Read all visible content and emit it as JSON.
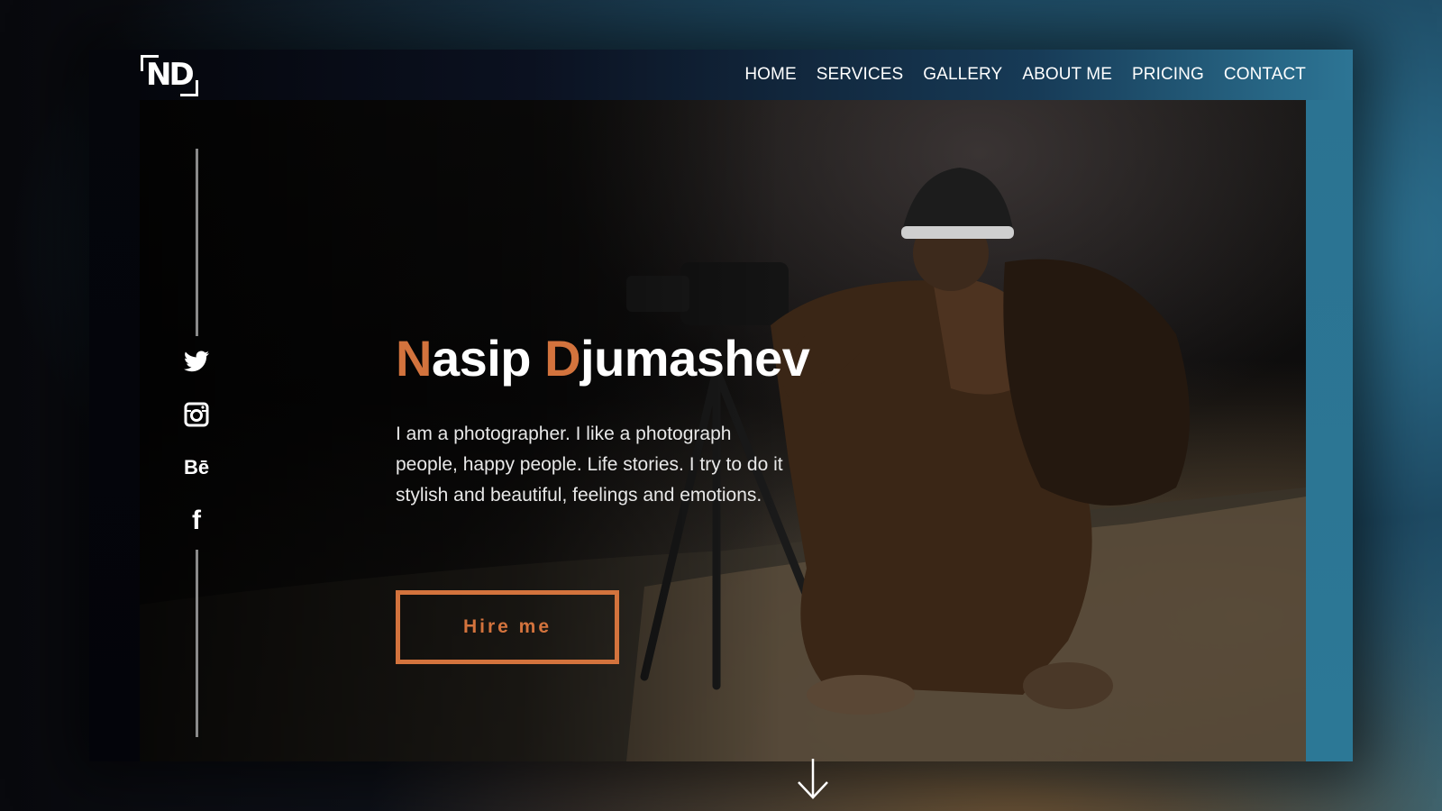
{
  "brand": {
    "logo_text": "ND"
  },
  "nav": {
    "items": [
      {
        "label": "HOME"
      },
      {
        "label": "SERVICES"
      },
      {
        "label": "GALLERY"
      },
      {
        "label": "ABOUT ME"
      },
      {
        "label": "PRICING"
      },
      {
        "label": "CONTACT"
      }
    ]
  },
  "hero": {
    "first_initial": "N",
    "first_rest": "asip ",
    "last_initial": "D",
    "last_rest": "jumashev",
    "description": "I am a photographer. I like a photograph people, happy people. Life stories. I try to do it stylish and beautiful, feelings and emotions.",
    "cta_label": "Hire me"
  },
  "social": [
    {
      "icon": "twitter-icon"
    },
    {
      "icon": "instagram-icon"
    },
    {
      "icon": "behance-icon",
      "glyph": "Bē"
    },
    {
      "icon": "facebook-icon",
      "glyph": "f"
    }
  ],
  "colors": {
    "accent": "#d3733d",
    "text": "#ffffff",
    "nav_bar_dark": "#0b1120",
    "nav_bar_light": "#2d7595"
  }
}
